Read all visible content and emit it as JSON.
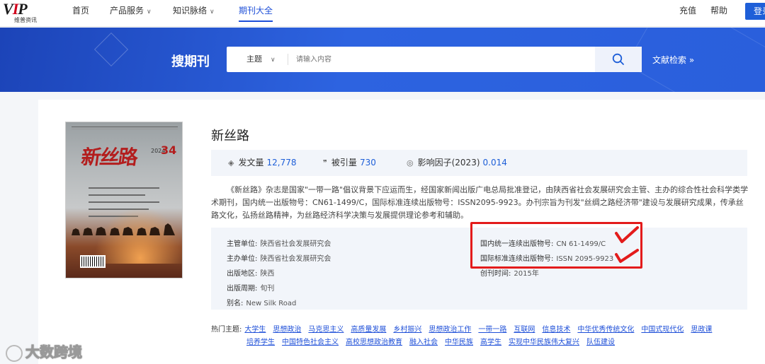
{
  "nav": {
    "logo_mark": "VIP",
    "logo_sub": "维普资讯",
    "items": [
      {
        "label": "首页"
      },
      {
        "label": "产品服务"
      },
      {
        "label": "知识脉络"
      },
      {
        "label": "期刊大全"
      }
    ],
    "recharge": "充值",
    "help": "帮助",
    "login": "登录"
  },
  "banner": {
    "title": "搜期刊",
    "search_type": "主题",
    "search_placeholder": "请输入内容",
    "advanced_link": "文献检索 »"
  },
  "journal": {
    "cover": {
      "title": "新丝路",
      "year": "2024",
      "issue": "34"
    },
    "title": "新丝路",
    "stats": [
      {
        "label": "发文量",
        "value": "12,778",
        "icon": "layers-icon"
      },
      {
        "label": "被引量",
        "value": "730",
        "icon": "quote-icon"
      },
      {
        "label": "影响因子(2023)",
        "value": "0.014",
        "icon": "impact-icon"
      }
    ],
    "description": "《新丝路》杂志是国家\"一带一路\"倡议背景下应运而生，经国家新闻出版广电总局批准登记，由陕西省社会发展研究会主管、主办的综合性社会科学类学术期刊，国内统一出版物号：CN61-1499/C，国际标准连续出版物号：ISSN2095-9923。办刊宗旨为刊发\"丝绸之路经济带\"建设与发展研究成果，传承丝路文化，弘扬丝路精神，为丝路经济科学决策与发展提供理论参考和辅助。",
    "info_left": [
      {
        "label": "主管单位:",
        "value": "陕西省社会发展研究会"
      },
      {
        "label": "主办单位:",
        "value": "陕西省社会发展研究会"
      },
      {
        "label": "出版地区:",
        "value": "陕西"
      },
      {
        "label": "出版周期:",
        "value": "旬刊"
      },
      {
        "label": "别名:",
        "value": "New Silk Road"
      }
    ],
    "info_right": [
      {
        "label": "国内统一连续出版物号:",
        "value": "CN 61-1499/C"
      },
      {
        "label": "国际标准连续出版物号:",
        "value": "ISSN 2095-9923"
      },
      {
        "label": "创刊时间:",
        "value": "2015年"
      }
    ],
    "hot_label": "热门主题:",
    "hot_topics": [
      "大学生",
      "思想政治",
      "马克思主义",
      "高质量发展",
      "乡村振兴",
      "思想政治工作",
      "一带一路",
      "互联网",
      "信息技术",
      "中华优秀传统文化",
      "中国式现代化",
      "思政课",
      "培养学生",
      "中国特色社会主义",
      "高校思想政治教育",
      "融入社会",
      "中华民族",
      "高学生",
      "实现中华民族伟大复兴",
      "队伍建设"
    ]
  },
  "watermark": "大数跨境",
  "colors": {
    "accent": "#1e5fd8",
    "highlight": "#e31b1b"
  }
}
